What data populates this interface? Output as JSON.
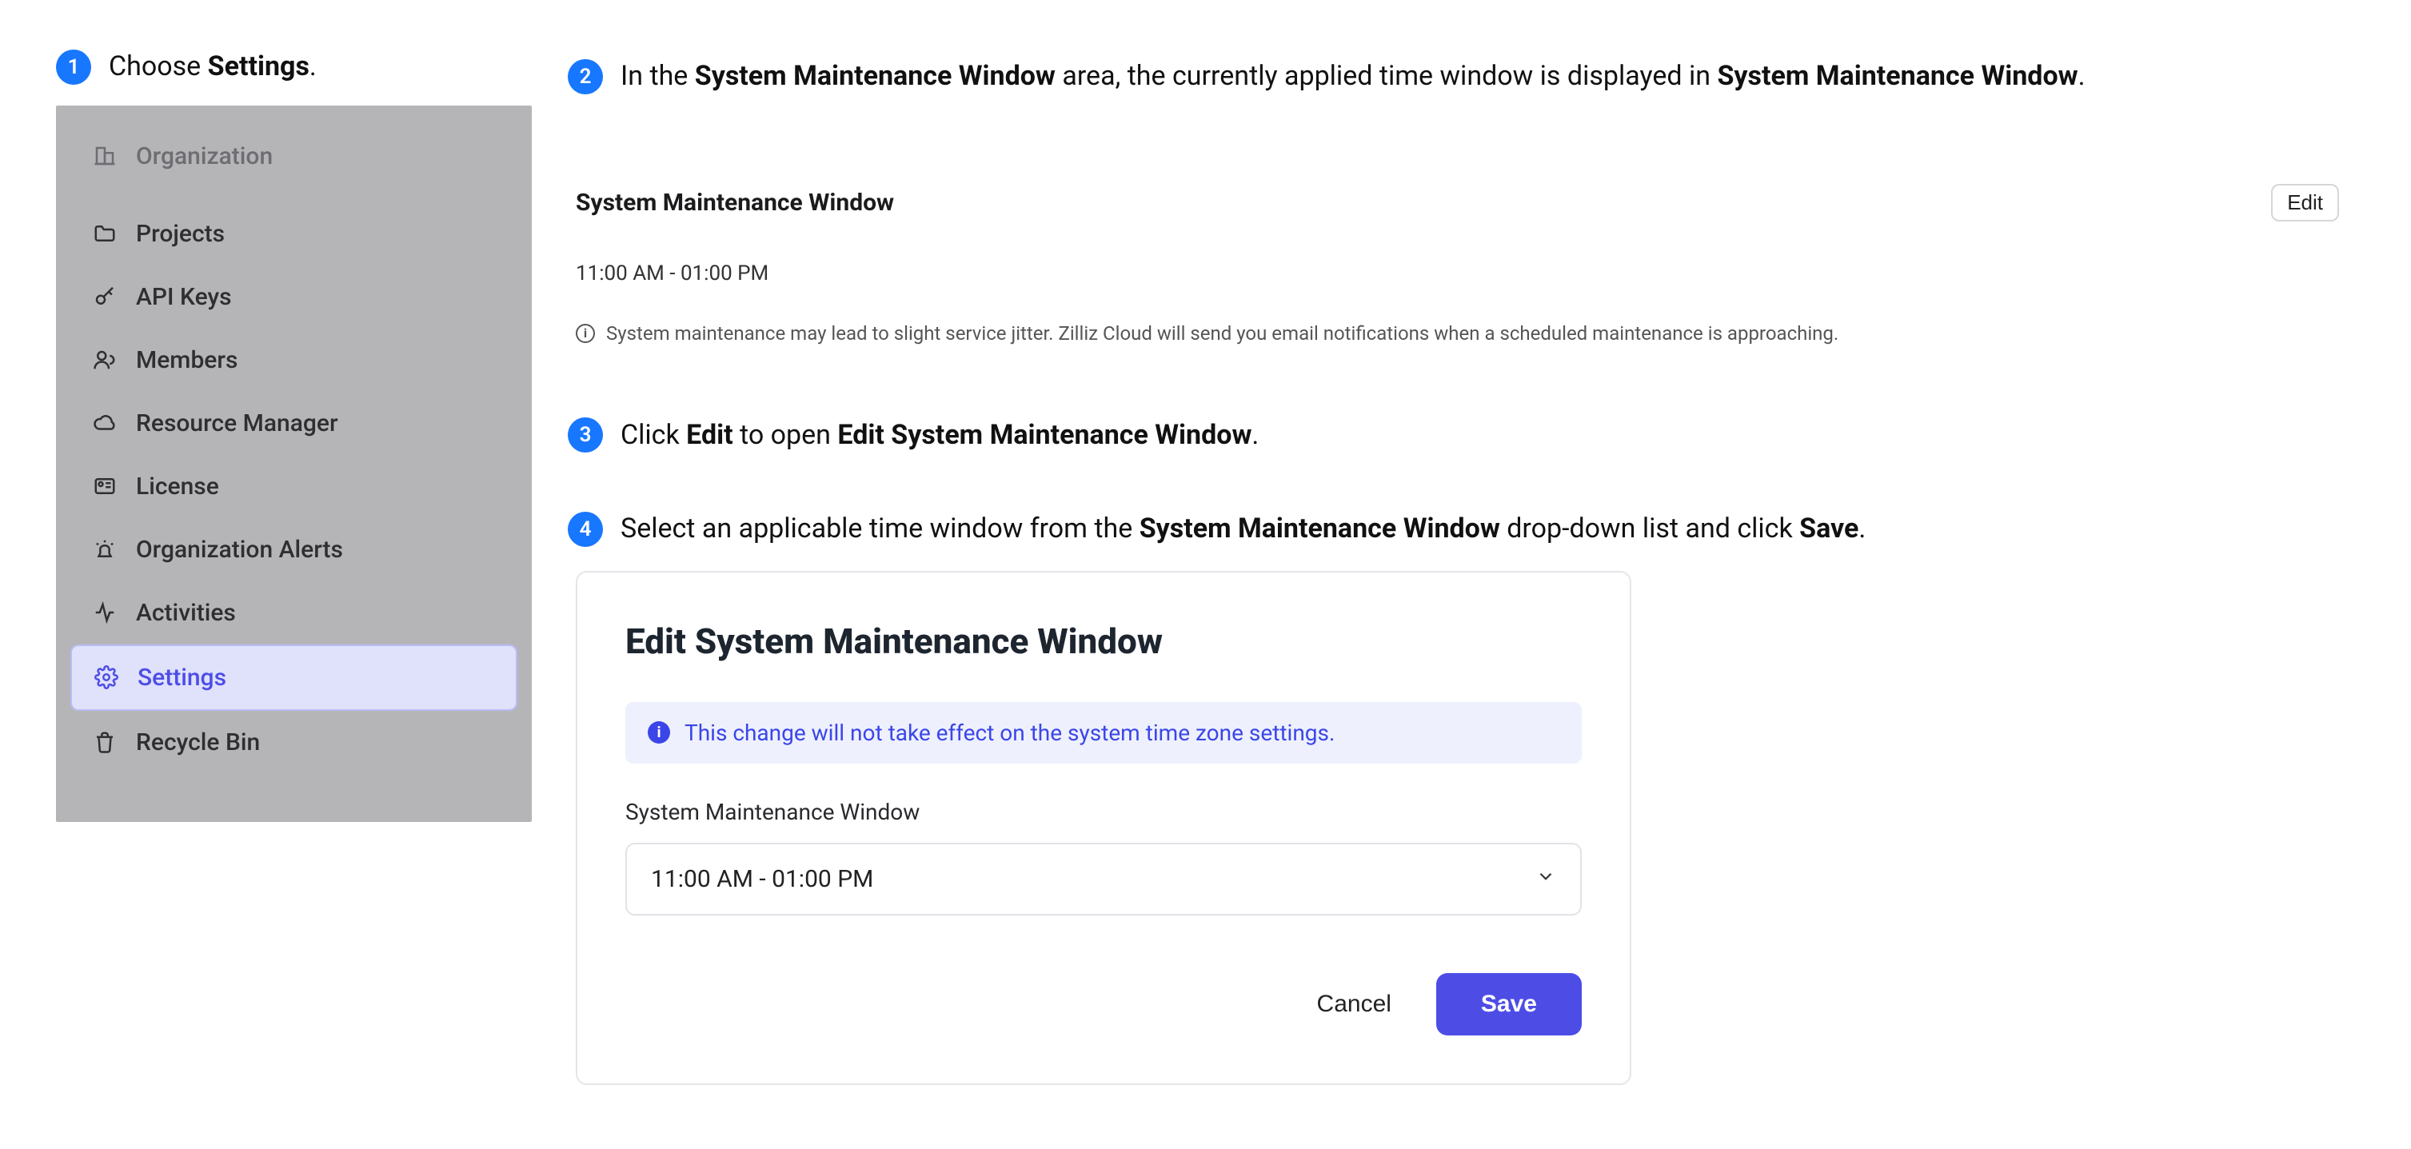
{
  "step1": {
    "num": "1",
    "prefix": "Choose ",
    "bold": "Settings",
    "suffix": "."
  },
  "sidebar": {
    "header": "Organization",
    "items": [
      {
        "label": "Projects"
      },
      {
        "label": "API Keys"
      },
      {
        "label": "Members"
      },
      {
        "label": "Resource Manager"
      },
      {
        "label": "License"
      },
      {
        "label": "Organization Alerts"
      },
      {
        "label": "Activities"
      },
      {
        "label": "Settings",
        "active": true
      },
      {
        "label": "Recycle Bin"
      }
    ]
  },
  "step2": {
    "num": "2",
    "text_pre": "In the ",
    "bold1": "System Maintenance Window",
    "text_mid": " area, the currently applied time window is displayed in ",
    "bold2": "System Maintenance Window",
    "text_post": "."
  },
  "smw_panel": {
    "title": "System Maintenance Window",
    "edit": "Edit",
    "time_range": "11:00 AM - 01:00 PM",
    "info_glyph": "i",
    "note": "System maintenance may lead to slight service jitter. Zilliz Cloud will send you email notifications when a scheduled maintenance is approaching."
  },
  "step3": {
    "num": "3",
    "text_pre": "Click ",
    "bold1": "Edit",
    "text_mid": " to open ",
    "bold2": "Edit System Maintenance Window",
    "text_post": "."
  },
  "step4": {
    "num": "4",
    "text_pre": "Select an applicable time window from the ",
    "bold1": "System Maintenance Window",
    "text_mid": " drop-down list and click ",
    "bold2": "Save",
    "text_post": "."
  },
  "dialog": {
    "title": "Edit System Maintenance Window",
    "banner_glyph": "i",
    "banner": "This change will not take effect on the system time zone settings.",
    "label": "System Maintenance Window",
    "value": "11:00 AM - 01:00 PM",
    "cancel": "Cancel",
    "save": "Save"
  }
}
